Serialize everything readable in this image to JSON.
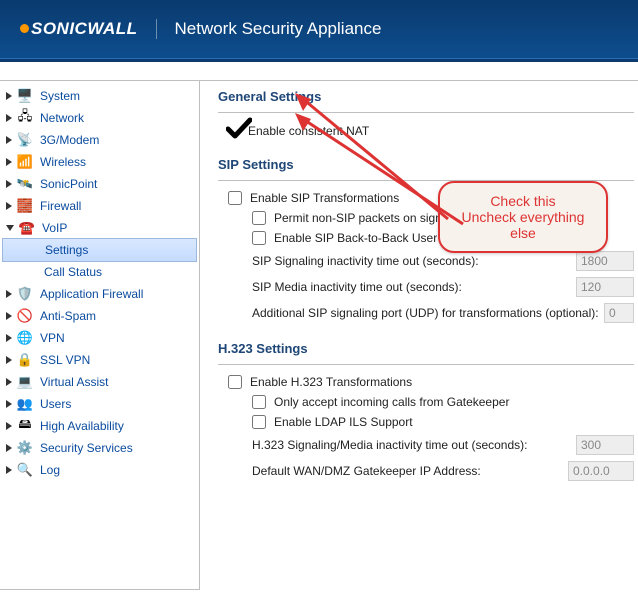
{
  "header": {
    "brand": "SONICWALL",
    "title": "Network Security Appliance"
  },
  "sidebar": {
    "items": [
      {
        "label": "System",
        "icon": "🖥️",
        "expanded": false
      },
      {
        "label": "Network",
        "icon": "🖧",
        "expanded": false
      },
      {
        "label": "3G/Modem",
        "icon": "📡",
        "expanded": false
      },
      {
        "label": "Wireless",
        "icon": "📶",
        "expanded": false
      },
      {
        "label": "SonicPoint",
        "icon": "🛰️",
        "expanded": false
      },
      {
        "label": "Firewall",
        "icon": "🧱",
        "expanded": false
      },
      {
        "label": "VoIP",
        "icon": "☎️",
        "expanded": true,
        "children": [
          {
            "label": "Settings",
            "selected": true
          },
          {
            "label": "Call Status",
            "selected": false
          }
        ]
      },
      {
        "label": "Application Firewall",
        "icon": "🛡️",
        "expanded": false
      },
      {
        "label": "Anti-Spam",
        "icon": "🚫",
        "expanded": false
      },
      {
        "label": "VPN",
        "icon": "🌐",
        "expanded": false
      },
      {
        "label": "SSL VPN",
        "icon": "🔒",
        "expanded": false
      },
      {
        "label": "Virtual Assist",
        "icon": "💻",
        "expanded": false
      },
      {
        "label": "Users",
        "icon": "👥",
        "expanded": false
      },
      {
        "label": "High Availability",
        "icon": "🖴",
        "expanded": false
      },
      {
        "label": "Security Services",
        "icon": "⚙️",
        "expanded": false
      },
      {
        "label": "Log",
        "icon": "🔍",
        "expanded": false
      }
    ]
  },
  "sections": {
    "general": {
      "title": "General Settings",
      "enable_consistent_nat": {
        "label": "Enable consistent NAT",
        "checked": true
      }
    },
    "sip": {
      "title": "SIP Settings",
      "enable_sip": {
        "label": "Enable SIP Transformations",
        "checked": false
      },
      "permit_non_sip": {
        "label": "Permit non-SIP packets on signaling port",
        "checked": false
      },
      "enable_b2bua": {
        "label": "Enable SIP Back-to-Back User Agent (B2BUA) support",
        "checked": false
      },
      "sig_timeout": {
        "label": "SIP Signaling inactivity time out (seconds):",
        "value": "1800"
      },
      "media_timeout": {
        "label": "SIP Media inactivity time out (seconds):",
        "value": "120"
      },
      "add_port": {
        "label": "Additional SIP signaling port (UDP) for transformations (optional):",
        "value": "0"
      }
    },
    "h323": {
      "title": "H.323 Settings",
      "enable_h323": {
        "label": "Enable H.323 Transformations",
        "checked": false
      },
      "only_gk": {
        "label": "Only accept incoming calls from Gatekeeper",
        "checked": false
      },
      "enable_ldap": {
        "label": "Enable LDAP ILS Support",
        "checked": false
      },
      "sig_timeout": {
        "label": "H.323 Signaling/Media inactivity time out (seconds):",
        "value": "300"
      },
      "gk_ip": {
        "label": "Default WAN/DMZ Gatekeeper IP Address:",
        "value": "0.0.0.0"
      }
    }
  },
  "annotation": {
    "line1": "Check this",
    "line2": "Uncheck everything else"
  }
}
